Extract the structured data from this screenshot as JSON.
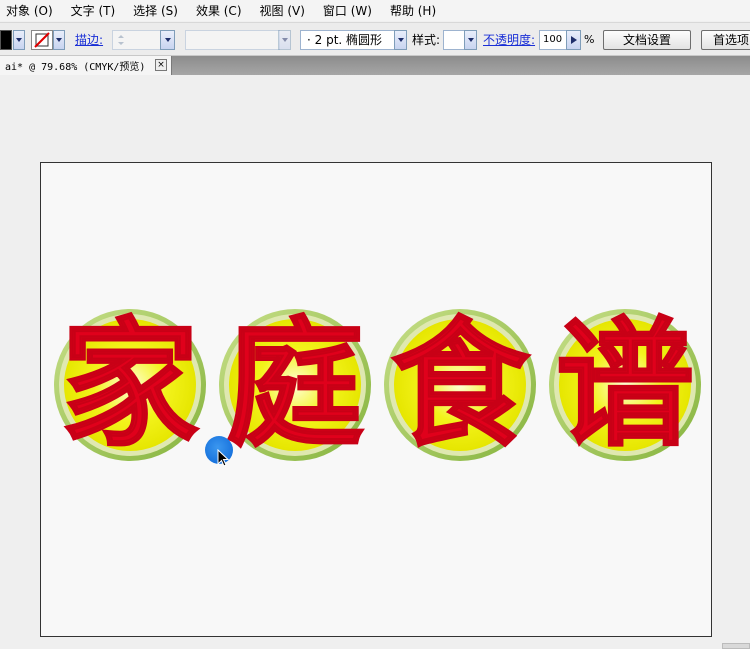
{
  "menu": [
    "对象 (O)",
    "文字 (T)",
    "选择 (S)",
    "效果 (C)",
    "视图 (V)",
    "窗口 (W)",
    "帮助 (H)"
  ],
  "toolbar": {
    "stroke_label": "描边:",
    "brush_label": "· 2 pt. 椭圆形",
    "style_label": "样式:",
    "opacity_label": "不透明度:",
    "opacity_value": "100",
    "opacity_unit": "%",
    "doc_setup_button": "文档设置",
    "preferences_button": "首选项"
  },
  "document_tab": {
    "title": "ai* @ 79.68% (CMYK/预览)",
    "close": "×"
  },
  "artwork": {
    "characters": [
      "家",
      "庭",
      "食",
      "谱"
    ],
    "text_color": "#e0001b",
    "ball_yellow": "#f1f10a",
    "ball_ring": "#a6cc5a"
  },
  "colors": {
    "link": "#1a2fd6",
    "cursor": "#0a64d6"
  }
}
